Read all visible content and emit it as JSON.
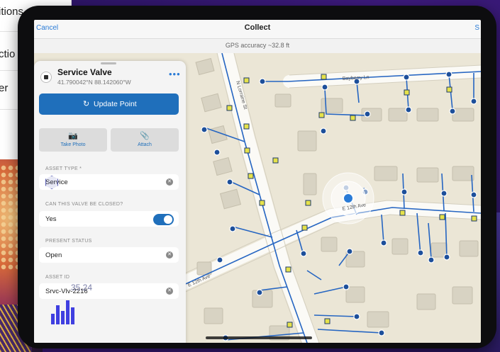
{
  "background": {
    "menu_items": [
      "itions",
      "ctio",
      "er"
    ]
  },
  "app": {
    "nav": {
      "cancel_label": "Cancel",
      "title": "Collect",
      "right_label": "S"
    },
    "gps_accuracy": "GPS accuracy ~32.8 ft"
  },
  "feature": {
    "title": "Service Valve",
    "coordinates": "41.790042°N  88.142060°W",
    "more_label": "•••",
    "update_point_label": "Update Point",
    "take_photo_label": "Take Photo",
    "attach_label": "Attach"
  },
  "form": {
    "fields": [
      {
        "label": "ASSET TYPE *",
        "value": "Service"
      },
      {
        "label": "CAN THIS VALVE BE CLOSED?",
        "value": "Yes",
        "toggle_on": true
      },
      {
        "label": "PRESENT STATUS",
        "value": "Open"
      },
      {
        "label": "ASSET ID",
        "value": "Srvc-Vlv-2216"
      }
    ]
  },
  "map": {
    "streets": [
      "Bayberry Ln",
      "N Lorraine St",
      "E 12th Ave",
      "E 12th Ave"
    ]
  },
  "overlay": {
    "number": "35.24",
    "bar_values": [
      0.45,
      0.8,
      0.55,
      1.0,
      0.7
    ]
  },
  "colors": {
    "accent": "#1f6fbb",
    "map_background": "#ebe6d6",
    "utility_line": "#2565c2"
  }
}
